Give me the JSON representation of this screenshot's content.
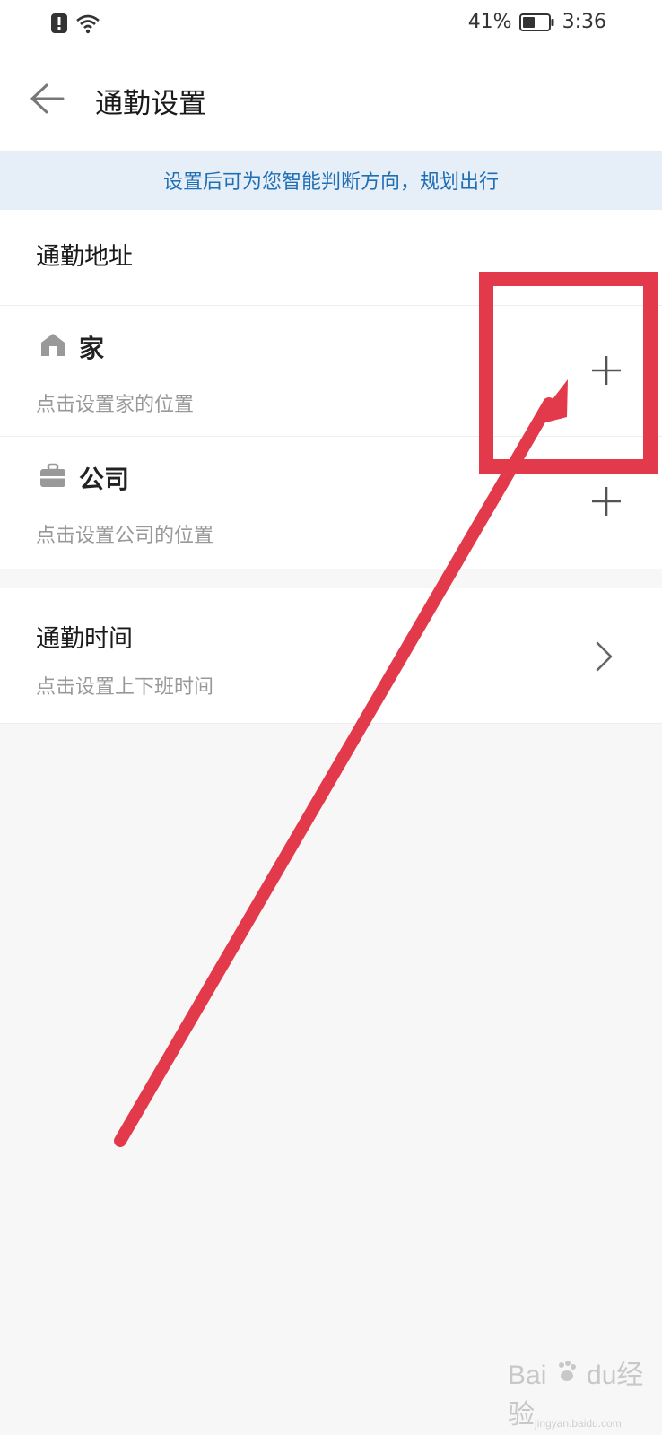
{
  "status_bar": {
    "battery_percent": "41%",
    "time": "3:36",
    "icons": [
      "alert-icon",
      "wifi-icon",
      "battery-icon"
    ]
  },
  "header": {
    "title": "通勤设置",
    "back_icon": "back-arrow-icon"
  },
  "banner": {
    "text": "设置后可为您智能判断方向，规划出行"
  },
  "commute_address": {
    "header": "通勤地址",
    "items": [
      {
        "label": "家",
        "subtitle": "点击设置家的位置",
        "icon": "home-icon",
        "action_icon": "plus-icon"
      },
      {
        "label": "公司",
        "subtitle": "点击设置公司的位置",
        "icon": "briefcase-icon",
        "action_icon": "plus-icon"
      }
    ]
  },
  "commute_time": {
    "title": "通勤时间",
    "subtitle": "点击设置上下班时间",
    "action_icon": "chevron-right-icon"
  },
  "annotation": {
    "color": "#e23a4a"
  },
  "watermark": {
    "brand": "Bai",
    "brand2": "du",
    "cn": "经验",
    "url": "jingyan.baidu.com"
  }
}
